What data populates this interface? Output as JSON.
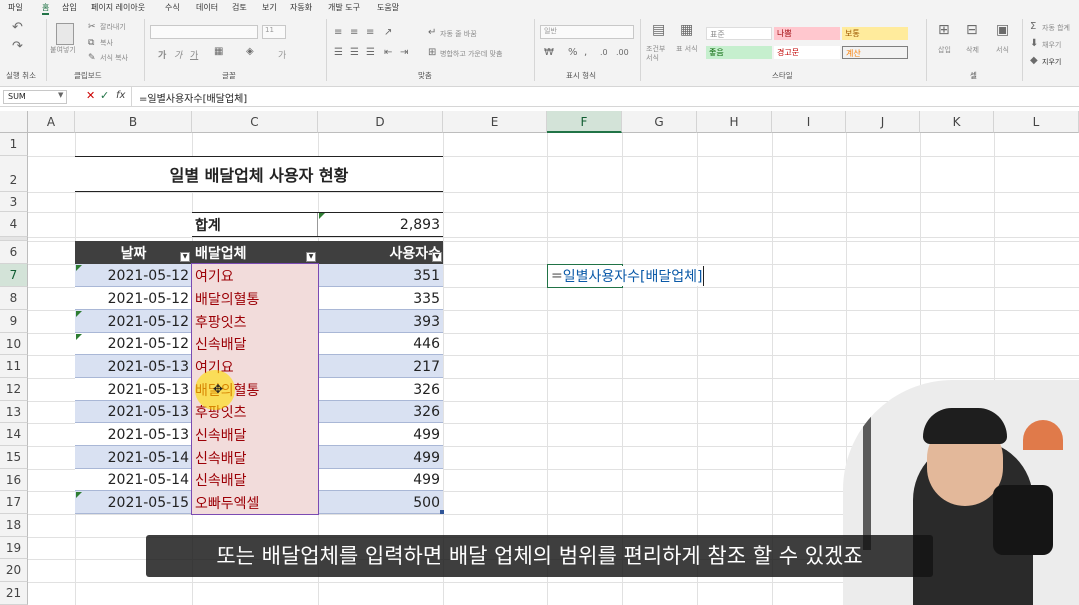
{
  "menu_tabs": [
    "파일",
    "홈",
    "삽입",
    "페이지 레이아웃",
    "수식",
    "데이터",
    "검토",
    "보기",
    "자동화",
    "개발 도구",
    "도움말"
  ],
  "ribbon": {
    "undo_group": "실행 취소",
    "clipboard": {
      "label": "클립보드",
      "paste": "붙여넣기",
      "cut": "잘라내기",
      "copy": "복사",
      "format_painter": "서식 복사"
    },
    "font": {
      "label": "글꼴",
      "font_name": "",
      "font_size": "11"
    },
    "alignment": {
      "label": "맞춤",
      "wrap": "자동 줄 바꿈",
      "merge": "병합하고 가운데 맞춤"
    },
    "number": {
      "label": "표시 형식",
      "format": "일반"
    },
    "styles": {
      "label": "스타일",
      "conditional": "조건부 서식",
      "table": "표 서식",
      "cells": [
        "표준",
        "나쁨",
        "보통",
        "좋음",
        "경고문",
        "계산"
      ]
    },
    "cells": {
      "label": "셀",
      "insert": "삽입",
      "delete": "삭제",
      "format": "서식"
    },
    "editing": {
      "autosum": "자동 합계",
      "fill": "채우기",
      "clear": "지우기"
    }
  },
  "formula_bar": {
    "name_box": "SUM",
    "fx": "fx",
    "formula": "=일별사용자수[배달업체]"
  },
  "columns": [
    "A",
    "B",
    "C",
    "D",
    "E",
    "F",
    "G",
    "H",
    "I",
    "J",
    "K",
    "L"
  ],
  "rows": [
    "1",
    "2",
    "3",
    "4",
    "6",
    "7",
    "8",
    "9",
    "10",
    "11",
    "12",
    "13",
    "14",
    "15",
    "16",
    "17",
    "18",
    "19",
    "20",
    "21"
  ],
  "sheet": {
    "title": "일별 배달업체 사용자 현황",
    "total_label": "합계",
    "total_value": "2,893",
    "headers": [
      "날짜",
      "배달업체",
      "사용자수"
    ],
    "data": [
      {
        "date": "2021-05-12",
        "company": "여기요",
        "users": "351"
      },
      {
        "date": "2021-05-12",
        "company": "배달의혈통",
        "users": "335"
      },
      {
        "date": "2021-05-12",
        "company": "후팡잇츠",
        "users": "393"
      },
      {
        "date": "2021-05-12",
        "company": "신속배달",
        "users": "446"
      },
      {
        "date": "2021-05-13",
        "company": "여기요",
        "users": "217"
      },
      {
        "date": "2021-05-13",
        "company": "배달의혈통",
        "users": "326"
      },
      {
        "date": "2021-05-13",
        "company": "후팡잇츠",
        "users": "326"
      },
      {
        "date": "2021-05-13",
        "company": "신속배달",
        "users": "499"
      },
      {
        "date": "2021-05-14",
        "company": "신속배달",
        "users": "499"
      },
      {
        "date": "2021-05-14",
        "company": "신속배달",
        "users": "499"
      },
      {
        "date": "2021-05-15",
        "company": "오빠두엑셀",
        "users": "500"
      }
    ],
    "editing_cell": {
      "eq": "=",
      "ref": "일별사용자수[배달업체]"
    }
  },
  "subtitle": "또는 배달업체를 입력하면 배달 업체의 범위를 편리하게 참조 할 수 있겠죠",
  "colors": {
    "accent": "#217346",
    "header_bg": "#3f3f3f",
    "band_blue": "#d9e1f2",
    "band_pink": "#f2dcdb",
    "pink_text": "#9c0006",
    "ref_blue": "#0b5aa8"
  }
}
